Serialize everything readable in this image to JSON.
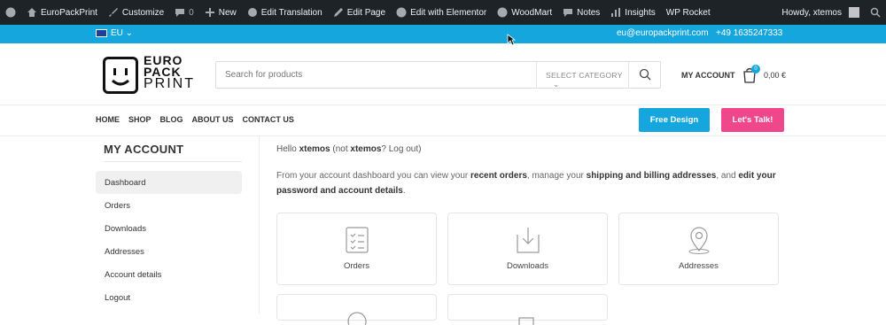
{
  "adminbar": {
    "site": "EuroPackPrint",
    "customize": "Customize",
    "comments_count": "0",
    "new": "New",
    "edit_translation": "Edit Translation",
    "edit_page": "Edit Page",
    "edit_elementor": "Edit with Elementor",
    "woodmart": "WoodMart",
    "notes": "Notes",
    "insights": "Insights",
    "wp_rocket": "WP Rocket",
    "howdy": "Howdy, xtemos"
  },
  "topbar": {
    "lang": "EU ⌄",
    "email": "eu@europackprint.com",
    "phone": "+49 1635247333",
    "color": "#16a6de"
  },
  "header": {
    "logo_line1": "EURO",
    "logo_line2": "PACK",
    "logo_line3": "PRINT",
    "search_placeholder": "Search for products",
    "category": "SELECT CATEGORY",
    "my_account": "MY ACCOUNT",
    "cart_count": "0",
    "cart_total": "0,00 €"
  },
  "nav": {
    "items": [
      "HOME",
      "SHOP",
      "BLOG",
      "ABOUT US",
      "CONTACT US"
    ],
    "free_design": "Free Design",
    "lets_talk": "Let's Talk!",
    "talk_color": "#f0468b"
  },
  "sidebar": {
    "title": "MY ACCOUNT",
    "items": [
      "Dashboard",
      "Orders",
      "Downloads",
      "Addresses",
      "Account details",
      "Logout"
    ]
  },
  "content": {
    "hello_prefix": "Hello ",
    "user": "xtemos",
    "hello_mid": " (not ",
    "user2": "xtemos",
    "hello_q": "? ",
    "logout": "Log out",
    "hello_end": ")",
    "intro_1": "From your account dashboard you can view your ",
    "recent_orders": "recent orders",
    "intro_2": ", manage your ",
    "addresses_link": "shipping and billing addresses",
    "intro_3": ", and ",
    "edit_link": "edit your password and account details",
    "intro_4": ".",
    "cards": [
      "Orders",
      "Downloads",
      "Addresses"
    ]
  }
}
